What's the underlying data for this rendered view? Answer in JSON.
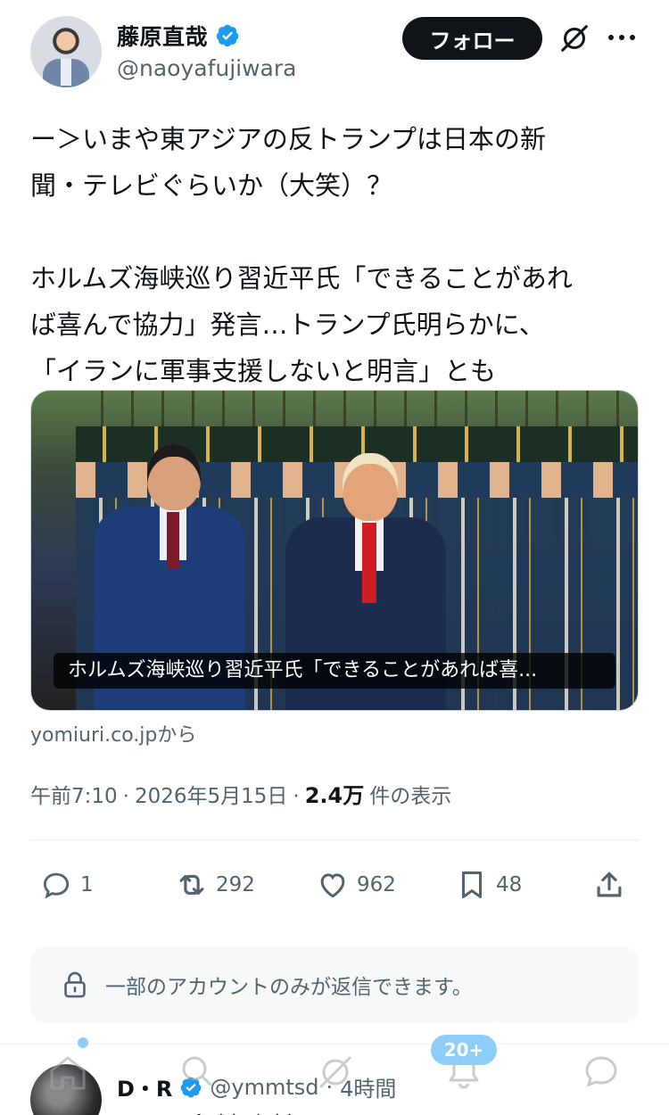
{
  "author": {
    "name": "藤原直哉",
    "handle": "@naoyafujiwara",
    "verified": true,
    "verified_color": "#1d9bf0"
  },
  "header": {
    "follow_label": "フォロー",
    "icons": [
      "grok-icon",
      "more-icon"
    ]
  },
  "post": {
    "text": "ー＞いまや東アジアの反トランプは日本の新\n聞・テレビぐらいか（大笑）？\n\nホルムズ海峡巡り習近平氏「できることがあれ\nば喜んで協力」発言…トランプ氏明らかに、\n「イランに軍事支援しないと明言」とも"
  },
  "link_card": {
    "caption": "ホルムズ海峡巡り習近平氏「できることがあれば喜...",
    "source": "yomiuri.co.jpから"
  },
  "meta": {
    "time": "午前7:10",
    "sep1": "·",
    "date": "2026年5月15日",
    "sep2": "·",
    "views_count": "2.4万",
    "views_label": "件の表示"
  },
  "actions": {
    "replies": "1",
    "reposts": "292",
    "likes": "962",
    "bookmarks": "48"
  },
  "reply_restriction": "一部のアカウントのみが返信できます。",
  "next_reply": {
    "name": "D・R",
    "handle": "@ymmtsd",
    "sep": "·",
    "time": "4時間",
    "text": "トランプ（米政府）の"
  },
  "tabbar": {
    "badge": "20+",
    "icons": [
      "home-icon",
      "search-icon",
      "grok-icon",
      "notifications-icon",
      "messages-icon"
    ]
  },
  "colors": {
    "accent": "#1d9bf0",
    "text": "#0f1419",
    "secondary": "#536471",
    "badge": "#8ecdf7"
  }
}
